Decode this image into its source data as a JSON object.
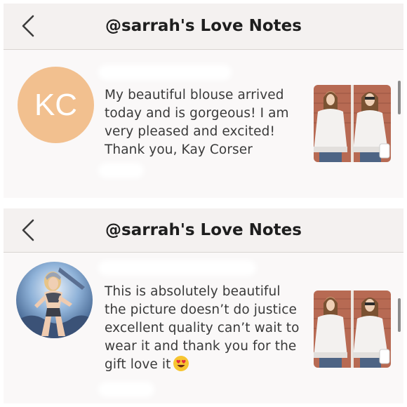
{
  "panels": [
    {
      "header": {
        "title": "@sarrah's Love Notes",
        "back_icon": "chevron-left-icon"
      },
      "avatar": {
        "initials": "KC",
        "color": "#f2c08f"
      },
      "message": {
        "lines": [
          "My beautiful blouse arrived",
          "today and is gorgeous! I am",
          "very pleased and excited!",
          "Thank you, Kay Corser"
        ]
      },
      "thumbnail": {
        "icon": "product-photo-white-lace-blouse"
      }
    },
    {
      "header": {
        "title": "@sarrah's Love Notes",
        "back_icon": "chevron-left-icon"
      },
      "avatar": {
        "icon": "fantasy-warrior-avatar-photo"
      },
      "message": {
        "lines": [
          "This is absolutely beautiful",
          "the picture doesn’t do justice",
          "excellent quality can’t wait to",
          "wear it and thank you for the",
          "gift love it"
        ],
        "emoji": "heart-eyes-emoji"
      },
      "thumbnail": {
        "icon": "product-photo-white-lace-blouse"
      }
    }
  ],
  "colors": {
    "header_bg": "#f4f1f0",
    "panel_bg": "#faf8f8",
    "avatar_kc": "#f2c08f",
    "text": "#3a3a3a"
  }
}
